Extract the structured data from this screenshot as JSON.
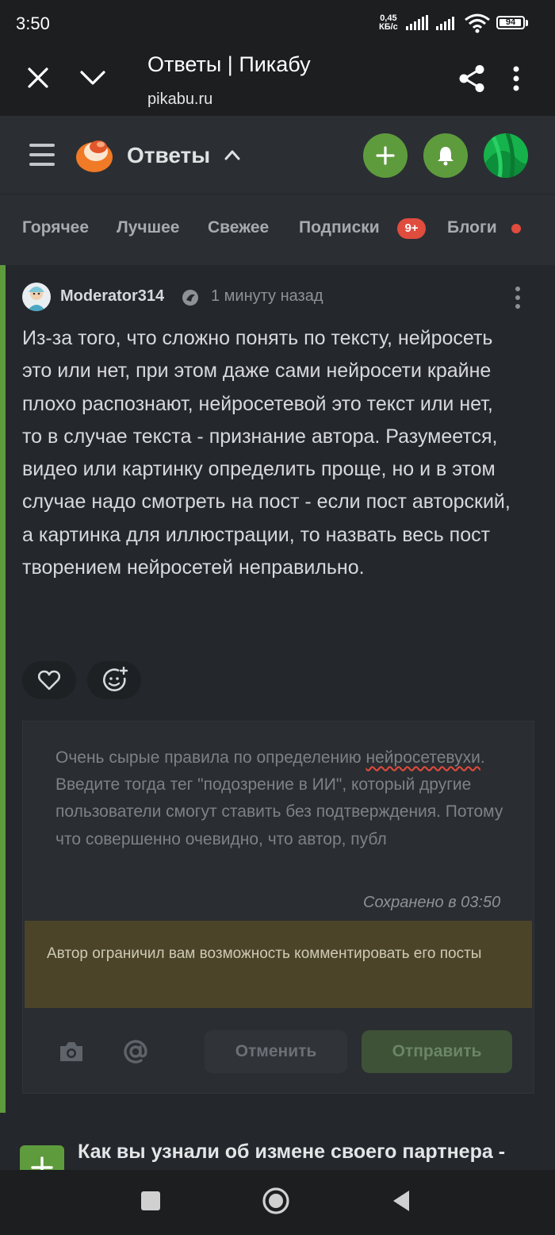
{
  "status_bar": {
    "time": "3:50",
    "net_speed_value": "0,45",
    "net_speed_unit": "КБ/с",
    "battery": "94"
  },
  "browser": {
    "title": "Ответы | Пикабу",
    "url": "pikabu.ru"
  },
  "header": {
    "section_title": "Ответы"
  },
  "tabs": [
    {
      "label": "Горячее"
    },
    {
      "label": "Лучшее"
    },
    {
      "label": "Свежее"
    },
    {
      "label": "Подписки",
      "badge": "9+"
    },
    {
      "label": "Блоги"
    }
  ],
  "comment": {
    "author": "Moderator314",
    "time_ago": "1 минуту назад",
    "text": "Из-за того, что сложно понять по тексту, нейросеть это или нет, при этом даже сами нейросети крайне плохо распознают, нейросетевой это текст или нет, то в случае текста - признание автора. Разумеется, видео или картинку определить проще, но и в этом случае надо смотреть на пост - если пост авторский, а картинка для иллюстрации, то назвать весь пост творением нейросетей неправильно."
  },
  "reply": {
    "draft_text_before": "Очень сырые правила по определению ",
    "draft_misspelled_word": "нейросетевухи",
    "draft_text_after": ". Введите тогда тег \"подозрение в ИИ\", который другие пользователи смогут ставить без подтверждения. Потому что совершенно очевидно, что автор, публ",
    "saved_status": "Сохранено в 03:50",
    "restriction_notice": "Автор ограничил вам возможность комментировать его посты",
    "cancel_label": "Отменить",
    "send_label": "Отправить"
  },
  "next_post": {
    "title": "Как вы узнали об измене своего партнера -"
  },
  "colors": {
    "accent_green": "#5e9b3d",
    "badge_red": "#e04c3d",
    "background": "#24272b"
  }
}
